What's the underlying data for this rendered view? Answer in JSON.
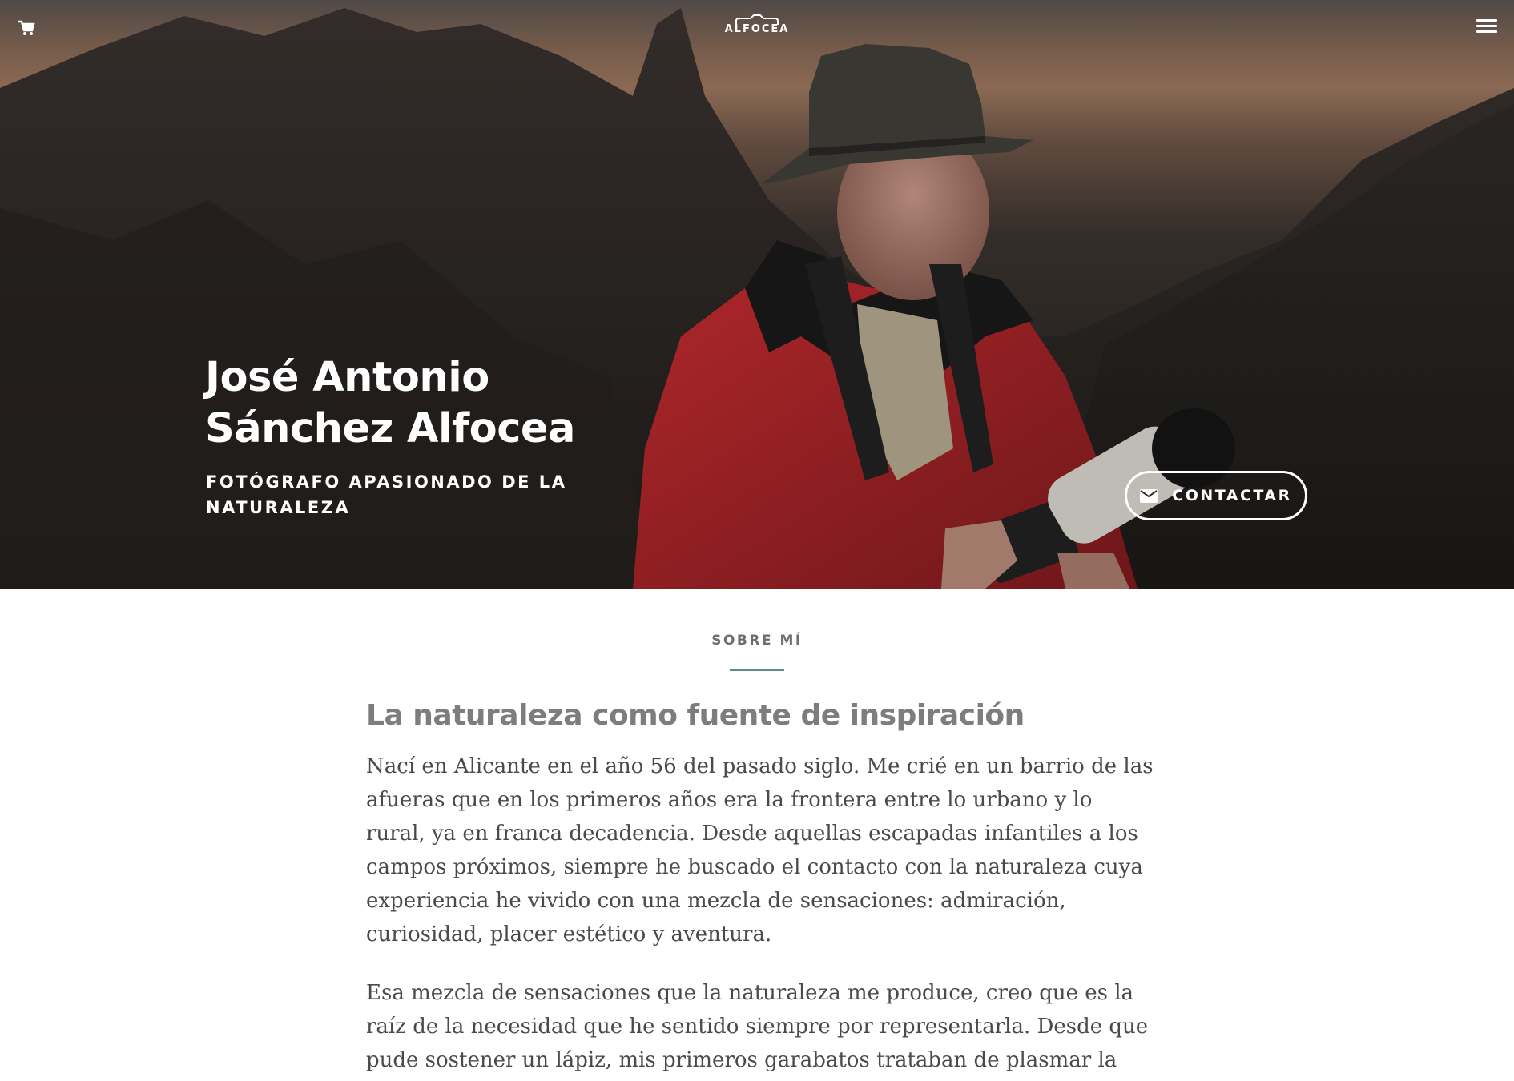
{
  "header": {
    "logo_text": "ALFOCEA",
    "cart_icon": "shopping-cart-icon",
    "menu_icon": "hamburger-menu-icon"
  },
  "hero": {
    "name": "José Antonio Sánchez Alfocea",
    "tagline": "Fotógrafo apasionado de la naturaleza",
    "contact_label": "CONTACTAR",
    "contact_icon": "envelope-icon"
  },
  "about": {
    "eyebrow": "SOBRE MÍ",
    "heading": "La naturaleza como fuente de inspiración",
    "paragraphs": [
      "Nací en Alicante en el año 56 del pasado siglo. Me crié en un barrio de las afueras que en los primeros años era la frontera entre lo urbano y lo rural, ya en franca decadencia. Desde aquellas escapadas infantiles a los campos próximos, siempre he buscado el contacto con la naturaleza cuya experiencia he vivido con una mezcla de sensaciones: admiración, curiosidad, placer estético y aventura.",
      "Esa mezcla de sensaciones que la naturaleza me produce, creo que es la raíz de la necesidad que he sentido siempre por representarla. Desde que pude sostener un lápiz, mis primeros garabatos trataban de plasmar la intensa"
    ]
  },
  "colors": {
    "accent_rule": "#5e8c8c",
    "jacket_red": "#b3262b",
    "body_text": "#4a4a4a"
  }
}
